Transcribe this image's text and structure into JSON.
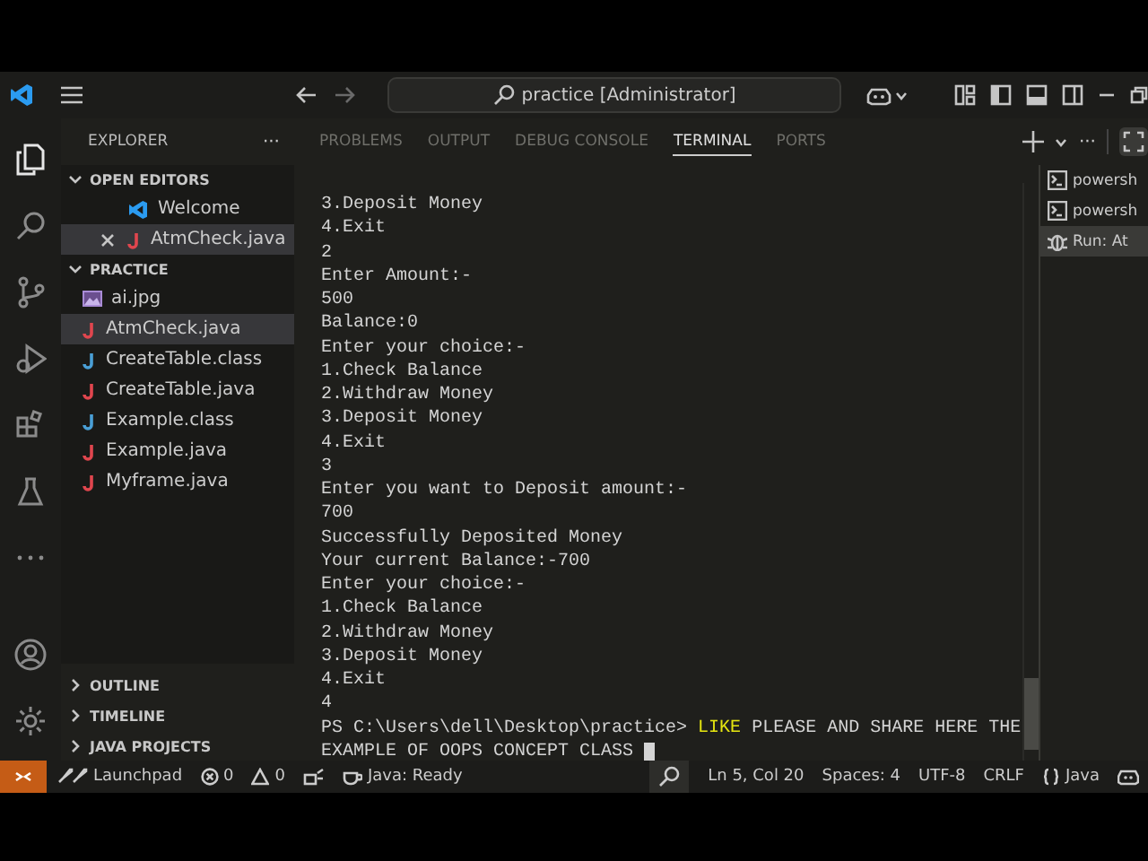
{
  "title_bar": {
    "search_text": "practice [Administrator]"
  },
  "sidebar": {
    "title": "EXPLORER",
    "more": "···",
    "open_editors": {
      "label": "OPEN EDITORS",
      "expanded": true,
      "items": [
        {
          "name": "Welcome",
          "kind": "vscode",
          "selected": false,
          "closable": false
        },
        {
          "name": "AtmCheck.java",
          "kind": "java",
          "selected": true,
          "closable": true
        }
      ]
    },
    "folder": {
      "label": "PRACTICE",
      "expanded": true,
      "items": [
        {
          "name": "ai.jpg",
          "kind": "image",
          "selected": false
        },
        {
          "name": "AtmCheck.java",
          "kind": "java",
          "selected": true
        },
        {
          "name": "CreateTable.class",
          "kind": "class",
          "selected": false
        },
        {
          "name": "CreateTable.java",
          "kind": "java",
          "selected": false
        },
        {
          "name": "Example.class",
          "kind": "class",
          "selected": false
        },
        {
          "name": "Example.java",
          "kind": "java",
          "selected": false
        },
        {
          "name": "Myframe.java",
          "kind": "java",
          "selected": false
        }
      ]
    },
    "sections": [
      {
        "label": "OUTLINE",
        "expanded": false
      },
      {
        "label": "TIMELINE",
        "expanded": false
      },
      {
        "label": "JAVA PROJECTS",
        "expanded": false
      }
    ]
  },
  "panel": {
    "tabs": [
      {
        "label": "PROBLEMS",
        "selected": false
      },
      {
        "label": "OUTPUT",
        "selected": false
      },
      {
        "label": "DEBUG CONSOLE",
        "selected": false
      },
      {
        "label": "TERMINAL",
        "selected": true
      },
      {
        "label": "PORTS",
        "selected": false
      }
    ],
    "more": "···"
  },
  "terminal": {
    "lines": [
      {
        "text": "3.Deposit Money"
      },
      {
        "text": "4.Exit"
      },
      {
        "text": "2"
      },
      {
        "text": "Enter Amount:-"
      },
      {
        "text": "500"
      },
      {
        "text": "Balance:0"
      },
      {
        "text": "Enter your choice:-"
      },
      {
        "text": "1.Check Balance"
      },
      {
        "text": "2.Withdraw Money"
      },
      {
        "text": "3.Deposit Money"
      },
      {
        "text": "4.Exit"
      },
      {
        "text": "3"
      },
      {
        "text": "Enter you want to Deposit amount:-"
      },
      {
        "text": "700"
      },
      {
        "text": "Successfully Deposited Money"
      },
      {
        "text": "Your current Balance:-700"
      },
      {
        "text": "Enter your choice:-"
      },
      {
        "text": "1.Check Balance"
      },
      {
        "text": "2.Withdraw Money"
      },
      {
        "text": "3.Deposit Money"
      },
      {
        "text": "4.Exit"
      },
      {
        "text": "4"
      },
      {
        "text": "PS C:\\Users\\dell\\Desktop\\practice> **LIKE** PLEASE AND SHARE HERE THE"
      },
      {
        "text": "EXAMPLE OF OOPS CONCEPT CLASS",
        "cursor": true
      }
    ]
  },
  "terminal_list": [
    {
      "label": "powersh",
      "kind": "shell",
      "selected": false
    },
    {
      "label": "powersh",
      "kind": "shell",
      "selected": false
    },
    {
      "label": "Run: At",
      "kind": "debug",
      "selected": true
    }
  ],
  "status_bar": {
    "left": [
      {
        "text": "Launchpad",
        "kind": "launchpad"
      },
      {
        "text": "0",
        "kind": "errors"
      },
      {
        "text": "0",
        "kind": "warnings"
      },
      {
        "kind": "ports"
      },
      {
        "text": "Java: Ready",
        "kind": "java-status"
      }
    ],
    "right": [
      {
        "kind": "zoom"
      },
      {
        "text": "Ln 5, Col 20",
        "kind": "text"
      },
      {
        "text": "Spaces: 4",
        "kind": "text"
      },
      {
        "text": "UTF-8",
        "kind": "text"
      },
      {
        "text": "CRLF",
        "kind": "text"
      },
      {
        "text": "Java",
        "kind": "language"
      },
      {
        "kind": "copilot"
      }
    ]
  }
}
